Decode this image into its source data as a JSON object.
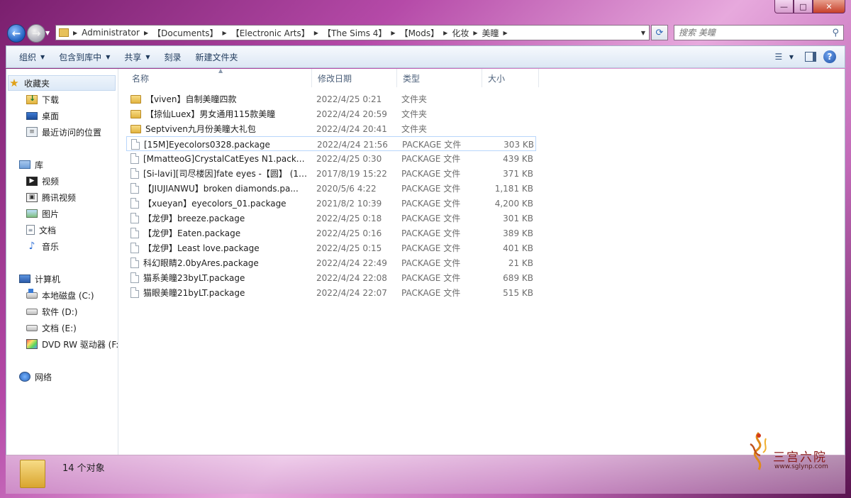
{
  "window": {
    "buttons": {
      "minimize": "—",
      "maximize": "□",
      "close": "✕"
    }
  },
  "address": {
    "crumbs": [
      "Administrator",
      "【Documents】",
      "【Electronic Arts】",
      "【The Sims 4】",
      "【Mods】",
      "化妆",
      "美瞳"
    ],
    "search_placeholder": "搜索 美瞳"
  },
  "toolbar": {
    "organize": "组织",
    "include_library": "包含到库中",
    "share": "共享",
    "burn": "刻录",
    "new_folder": "新建文件夹"
  },
  "nav": {
    "favorites": "收藏夹",
    "downloads": "下载",
    "desktop": "桌面",
    "recent": "最近访问的位置",
    "libraries": "库",
    "videos": "视频",
    "tencent_video": "腾讯视频",
    "pictures": "图片",
    "documents": "文档",
    "music": "音乐",
    "computer": "计算机",
    "disk_c": "本地磁盘 (C:)",
    "disk_d": "软件 (D:)",
    "disk_e": "文档 (E:)",
    "dvd": "DVD RW 驱动器 (F:",
    "network": "网络"
  },
  "columns": {
    "name": "名称",
    "date": "修改日期",
    "type": "类型",
    "size": "大小"
  },
  "files": [
    {
      "name": "【viven】自制美瞳四款",
      "date": "2022/4/25 0:21",
      "type": "文件夹",
      "size": "",
      "kind": "folder"
    },
    {
      "name": "【掠仙Luex】男女通用115款美瞳",
      "date": "2022/4/24 20:59",
      "type": "文件夹",
      "size": "",
      "kind": "folder"
    },
    {
      "name": "Septviven九月份美瞳大礼包",
      "date": "2022/4/24 20:41",
      "type": "文件夹",
      "size": "",
      "kind": "folder"
    },
    {
      "name": "[15M]Eyecolors0328.package",
      "date": "2022/4/24 21:56",
      "type": "PACKAGE 文件",
      "size": "303 KB",
      "kind": "file"
    },
    {
      "name": "[MmatteoG]CrystalCatEyes N1.packa...",
      "date": "2022/4/25 0:30",
      "type": "PACKAGE 文件",
      "size": "439 KB",
      "kind": "file"
    },
    {
      "name": "[Si-lavi][司尽楼因]fate eyes -【圆】 (1)....",
      "date": "2017/8/19 15:22",
      "type": "PACKAGE 文件",
      "size": "371 KB",
      "kind": "file"
    },
    {
      "name": "【JIUJIANWU】broken diamonds.pa...",
      "date": "2020/5/6 4:22",
      "type": "PACKAGE 文件",
      "size": "1,181 KB",
      "kind": "file"
    },
    {
      "name": "【xueyan】eyecolors_01.package",
      "date": "2021/8/2 10:39",
      "type": "PACKAGE 文件",
      "size": "4,200 KB",
      "kind": "file"
    },
    {
      "name": "【龙伊】breeze.package",
      "date": "2022/4/25 0:18",
      "type": "PACKAGE 文件",
      "size": "301 KB",
      "kind": "file"
    },
    {
      "name": "【龙伊】Eaten.package",
      "date": "2022/4/25 0:16",
      "type": "PACKAGE 文件",
      "size": "389 KB",
      "kind": "file"
    },
    {
      "name": "【龙伊】Least love.package",
      "date": "2022/4/25 0:15",
      "type": "PACKAGE 文件",
      "size": "401 KB",
      "kind": "file"
    },
    {
      "name": "科幻眼睛2.0byAres.package",
      "date": "2022/4/24 22:49",
      "type": "PACKAGE 文件",
      "size": "21 KB",
      "kind": "file"
    },
    {
      "name": "猫系美瞳23byLT.package",
      "date": "2022/4/24 22:08",
      "type": "PACKAGE 文件",
      "size": "689 KB",
      "kind": "file"
    },
    {
      "name": "猫眼美瞳21byLT.package",
      "date": "2022/4/24 22:07",
      "type": "PACKAGE 文件",
      "size": "515 KB",
      "kind": "file"
    }
  ],
  "status": {
    "count": "14 个对象"
  },
  "watermark": {
    "text": "三宫六院",
    "url": "www.sglynp.com"
  }
}
